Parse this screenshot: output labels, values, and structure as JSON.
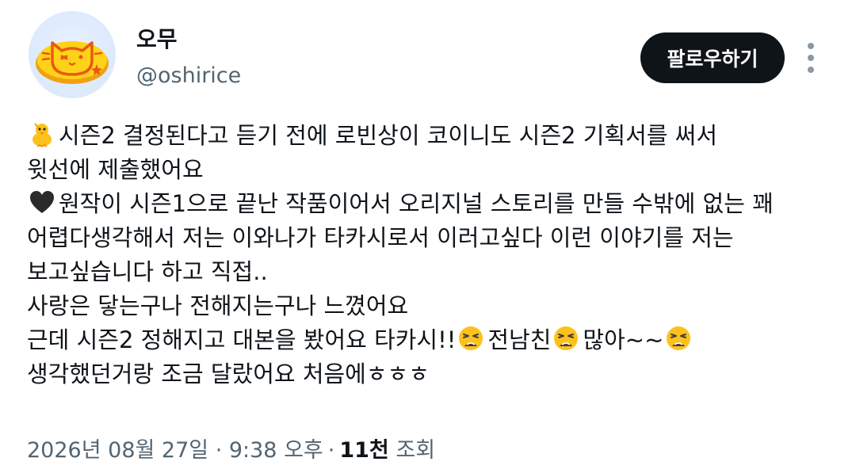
{
  "author": {
    "display_name": "오무",
    "handle": "@oshirice",
    "avatar_icon": "cat-omurice-avatar"
  },
  "actions": {
    "follow_label": "팔로우하기",
    "more_icon": "more-vertical-icon"
  },
  "post": {
    "lines": [
      {
        "emoji": "baby-chick-emoji",
        "text": "시즌2 결정된다고 듣기 전에 로빈상이 코이니도 시즌2 기획서를 써서"
      },
      {
        "text": "윗선에 제출했어요"
      },
      {
        "emoji": "black-heart-emoji",
        "text": "원작이 시즌1으로 끝난 작품이어서 오리지널 스토리를 만들 수밖에 없는 꽤"
      },
      {
        "text": "어렵다생각해서 저는 이와나가 타카시로서 이러고싶다 이런 이야기를 저는"
      },
      {
        "text": "보고싶습니다 하고 직접.."
      },
      {
        "text": "사랑은 닿는구나 전해지는구나 느꼈어요"
      },
      {
        "segments": [
          "근데 시즌2 정해지고 대본을 봤어요 타카시!!",
          "전남친",
          "많아~~"
        ],
        "emoji": "weary-face-emoji"
      },
      {
        "text": "생각했던거랑 조금 달랐어요 처음에ㅎㅎㅎ"
      }
    ]
  },
  "meta": {
    "timestamp": "2026년 08월 27일 · 9:38 오후",
    "separator": "·",
    "views_count": "11천",
    "views_label": "조회"
  }
}
